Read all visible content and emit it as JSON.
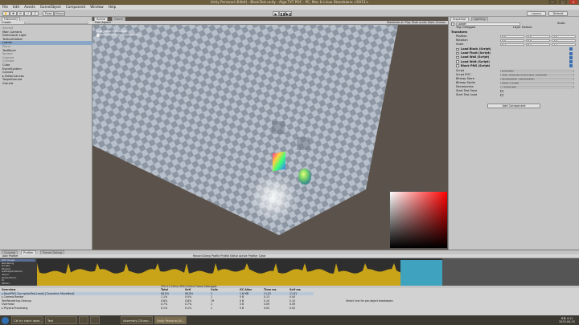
{
  "window": {
    "title": "Unity Personal (64bit) - BlockTest.unity - Algo.TXT POC - PC, Mac & Linux Standalone <DX11>"
  },
  "window_controls": [
    "—",
    "□",
    "✕"
  ],
  "menu": [
    "File",
    "Edit",
    "Assets",
    "GameObject",
    "Component",
    "Window",
    "Help"
  ],
  "toolbar": {
    "pivot": "Pivot",
    "global": "Global",
    "layers": "Layers",
    "layout": "Default"
  },
  "hierarchy": {
    "tab": "Hierarchy",
    "create": "Create",
    "items": [
      {
        "label": "Scene3",
        "grey": true,
        "selected": false
      },
      {
        "label": "Main Camera",
        "grey": false,
        "selected": false
      },
      {
        "label": "Directional Light",
        "grey": false,
        "selected": false
      },
      {
        "label": "TextureHolder",
        "grey": false,
        "selected": false
      },
      {
        "label": "Loader",
        "grey": false,
        "selected": true
      },
      {
        "label": "Plane",
        "grey": true,
        "selected": false
      },
      {
        "label": "TestBlock",
        "grey": false,
        "selected": false
      },
      {
        "label": "Sphere",
        "grey": true,
        "selected": false
      },
      {
        "label": "Capsule",
        "grey": true,
        "selected": false
      },
      {
        "label": "Cylinder",
        "grey": true,
        "selected": false
      },
      {
        "label": "Cube",
        "grey": false,
        "selected": false
      },
      {
        "label": "EventSystem",
        "grey": false,
        "selected": false
      },
      {
        "label": "Canvas",
        "grey": false,
        "selected": false
      },
      {
        "label": "▸ EditorCanvas",
        "grey": false,
        "selected": false
      },
      {
        "label": "TargetGround",
        "grey": false,
        "selected": false
      },
      {
        "label": "Ground",
        "grey": false,
        "selected": false
      }
    ]
  },
  "scene": {
    "tabs": [
      "Scene",
      "Game"
    ],
    "aspect": "Free Aspect",
    "maximize": "Maximize on Play  Mute audio  Stats  Gizmos",
    "overlay": "Edit Color Selection"
  },
  "inspector": {
    "tabs": [
      "Inspector",
      "Lighting"
    ],
    "object_name": "Loader",
    "static": "Static",
    "tag": "Tag  Untagged",
    "layer": "Layer  Default",
    "transform_label": "Transform",
    "transform": [
      {
        "label": "Position",
        "x": "X 0",
        "y": "Y 0",
        "z": "Z 0"
      },
      {
        "label": "Rotation",
        "x": "X 0",
        "y": "Y 0",
        "z": "Z 0"
      },
      {
        "label": "Scale",
        "x": "X 1",
        "y": "Y 1",
        "z": "Z 1"
      }
    ],
    "components": [
      "Load Block (Script)",
      "Load Float (Script)",
      "Load Wall (Script)",
      "Load Walt (Script)",
      "Block PNG (Script)"
    ],
    "fields": [
      {
        "label": "Script",
        "value": "BlockPNG"
      },
      {
        "label": "Script POC",
        "value": "TextController (BlockTextController)"
      },
      {
        "label": "Bitmap Store",
        "value": "PaintBitmap (PaintImage)"
      },
      {
        "label": "Bitmap Sprite",
        "value": "None (Sprite)"
      },
      {
        "label": "Decompress",
        "value": "ColorPicker"
      },
      {
        "label": "Start Test Save",
        "value": ""
      },
      {
        "label": "Start Test Load",
        "value": ""
      }
    ],
    "add_component": "Add Component"
  },
  "profiler": {
    "tabs": [
      "Console",
      "Profiler",
      "Frame Debug"
    ],
    "add_profiler": "Add Profiler",
    "record_controls": "Record  Deep Profile  Profile Editor  Active Profiler  Clear",
    "labels": [
      "CPU Usage",
      "Rendering",
      "Scripts",
      "Physics",
      "GarbageCollector",
      "VSync",
      "Global Illum.",
      "UI",
      "Others"
    ],
    "frame_info": "CPU:12.20ms   GPU:0.00ms   Frame Debugger",
    "columns": [
      "Overview",
      "Total",
      "Self",
      "Calls",
      "GC Alloc",
      "Time ms",
      "Self ms"
    ],
    "rows": [
      {
        "name": "▸ BlockPNG.CorruptionTest.Load() [Coroutine: MoveNext]",
        "total": "96.8%",
        "self": "96.8%",
        "calls": "1",
        "gc": "1.8 MB",
        "time": "11.81",
        "selfms": "11.81"
      },
      {
        "name": "▸ Camera.Render",
        "total": "1.1%",
        "self": "0.0%",
        "calls": "1",
        "gc": "0 B",
        "time": "0.13",
        "selfms": "0.00"
      },
      {
        "name": "  TextRendering.Cleanup",
        "total": "0.8%",
        "self": "0.8%",
        "calls": "79",
        "gc": "0 B",
        "time": "0.10",
        "selfms": "0.10"
      },
      {
        "name": "  Overhead",
        "total": "0.7%",
        "self": "0.7%",
        "calls": "1",
        "gc": "0 B",
        "time": "0.09",
        "selfms": "0.09"
      },
      {
        "name": "▸ Physics.Processing",
        "total": "0.1%",
        "self": "0.1%",
        "calls": "1",
        "gc": "0 B",
        "time": "0.02",
        "selfms": "0.02"
      }
    ],
    "detail_hint": "Select Line for per-object breakdown"
  },
  "taskbar": {
    "items": [
      "C# try catch does...",
      "Test",
      "",
      "",
      "Assembly-CSharp...",
      "Unity Personal (6..."
    ],
    "time": "오후 4:11",
    "date": "2015-04-15"
  },
  "colors": {
    "graph_yellow": "#c9a418",
    "graph_cyan": "#3fa3bf",
    "selection": "#8aa7c8"
  }
}
